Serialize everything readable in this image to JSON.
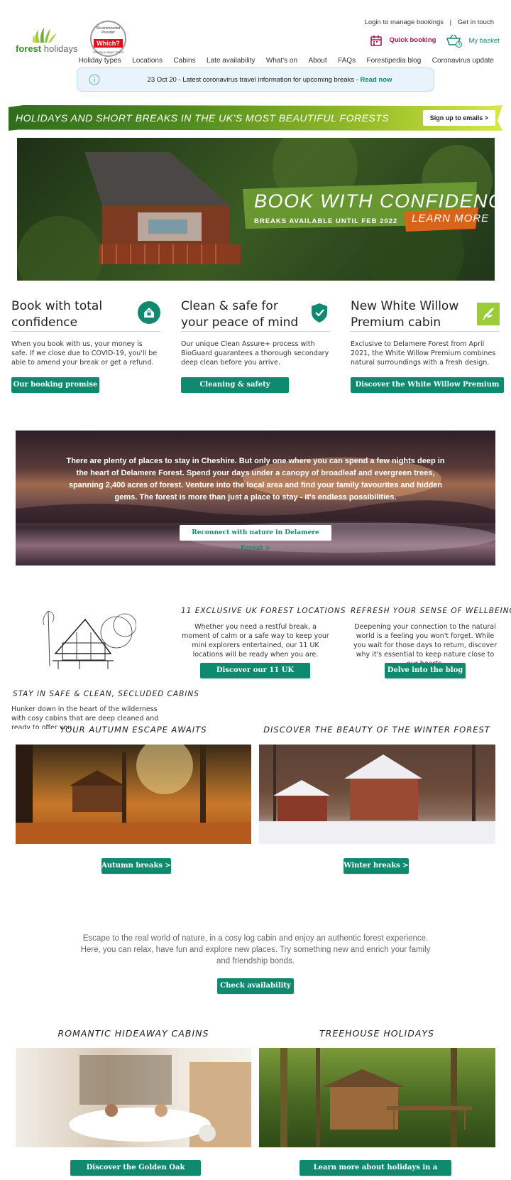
{
  "header": {
    "logo_text_forest": "forest",
    "logo_text_holidays": "holidays",
    "which_badge": {
      "top": "Recommended Provider",
      "center": "Which?",
      "bottom": "Holiday Lodges Parks"
    },
    "top_links": [
      "Login to manage bookings",
      "Get in touch"
    ],
    "quick_booking": "Quick booking",
    "basket": "My basket",
    "basket_count": "0",
    "nav": [
      "Holiday types",
      "Locations",
      "Cabins",
      "Late availability",
      "What's on",
      "About",
      "FAQs",
      "Forestipedia blog",
      "Coronavirus update"
    ]
  },
  "alert": {
    "text": "23 Oct 20 - Latest coronavirus travel information for upcoming breaks - ",
    "link": "Read now"
  },
  "banner": {
    "title": "HOLIDAYS AND SHORT BREAKS IN THE UK'S MOST BEAUTIFUL FORESTS",
    "button": "Sign up to emails  >"
  },
  "hero": {
    "headline": "BOOK WITH CONFIDENCE",
    "sub": "BREAKS AVAILABLE UNTIL FEB 2022",
    "cta": "LEARN MORE"
  },
  "features": [
    {
      "title": "Book with total confidence",
      "text": "When you book with us, your money is safe. If we close due to COVID-19, you'll be able to amend your break or get a refund.",
      "button": "Our booking promise  >",
      "icon": "house-lock-icon"
    },
    {
      "title": "Clean & safe for your peace of mind",
      "text": "Our unique Clean Assure+ process with BioGuard guarantees a thorough secondary deep clean before you arrive.",
      "button": "Cleaning & safety processes  >",
      "icon": "shield-check-icon"
    },
    {
      "title": "New White Willow Premium cabin",
      "text": "Exclusive to Delamere Forest from April 2021, the White Willow Premium combines natural surroundings with a fresh design.",
      "button": "Discover the White Willow Premium cabin  >",
      "icon": "willow-leaf-icon"
    }
  ],
  "delamere": {
    "text": "There are plenty of places to stay in Cheshire. But only one where you can spend a few nights deep in the heart of Delamere Forest. Spend your days under a canopy of broadleaf and evergreen trees, spanning 2,400 acres of forest. Venture into the local area and find your family favourites and hidden gems. The forest is more than just a place to stay - it's endless possibilities.",
    "button": "Reconnect with nature in Delamere Forest  >"
  },
  "info": {
    "cabins_title": "STAY IN SAFE & CLEAN, SECLUDED CABINS",
    "cabins_text": "Hunker down in the heart of the wilderness with cosy cabins that are deep cleaned and ready to offer you",
    "locations_title": "11 EXCLUSIVE UK FOREST LOCATIONS",
    "locations_text": "Whether you need a restful break, a moment of calm or a safe way to keep your mini explorers entertained, our 11 UK locations will be ready when you are.",
    "locations_button": "Discover our 11 UK locations  >",
    "wellbeing_title": "REFRESH YOUR SENSE OF WELLBEING",
    "wellbeing_text": "Deepening your connection to the natural world is a feeling you won't forget. While you wait for those days to return, discover why it's essential to keep nature close to our hearts.",
    "wellbeing_button": "Delve into the blog  >"
  },
  "seasons": [
    {
      "title": "YOUR AUTUMN ESCAPE AWAITS",
      "button": "Autumn breaks  >"
    },
    {
      "title": "DISCOVER THE BEAUTY OF THE WINTER FOREST",
      "button": "Winter breaks  >"
    }
  ],
  "escape": {
    "text": "Escape to the real world of nature, in a cosy log cabin and enjoy an authentic forest experience. Here, you can relax, have fun and explore new places. Try something new and enrich your family and friendship bonds.",
    "button": "Check availability  >"
  },
  "bottom": [
    {
      "title": "ROMANTIC HIDEAWAY CABINS",
      "button": "Discover the Golden Oak Hideaway  >"
    },
    {
      "title": "TREEHOUSE HOLIDAYS",
      "button": "Learn more about holidays in a treehouse  >"
    }
  ],
  "colors": {
    "accent": "#0f8a6e",
    "brand_green": "#7ab648",
    "quick_booking": "#b5124b",
    "link": "#0f8a6e"
  }
}
